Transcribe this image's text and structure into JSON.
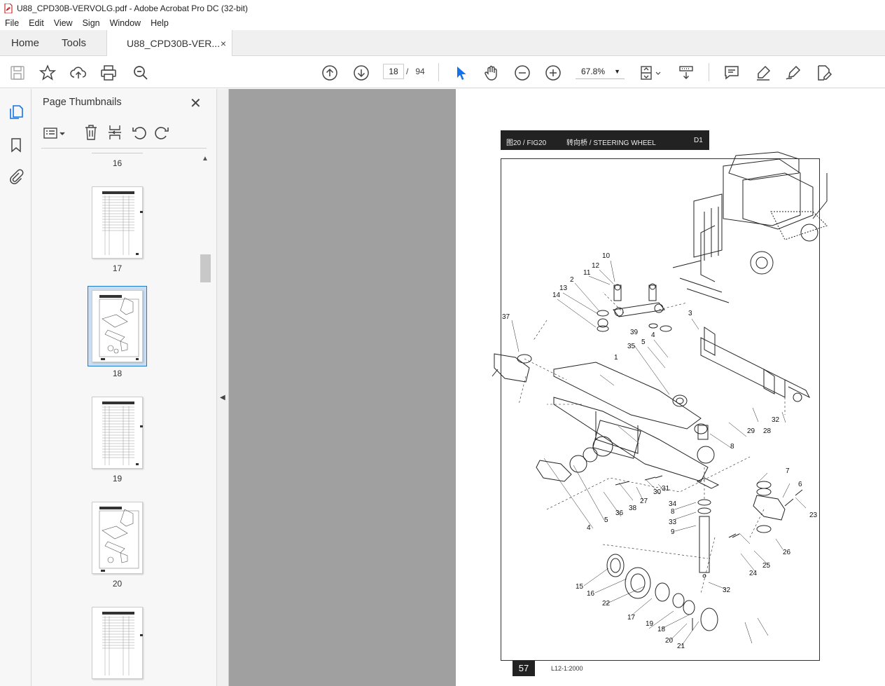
{
  "window": {
    "title": "U88_CPD30B-VERVOLG.pdf - Adobe Acrobat Pro DC (32-bit)"
  },
  "menu": [
    "File",
    "Edit",
    "View",
    "Sign",
    "Window",
    "Help"
  ],
  "tabs": {
    "home": "Home",
    "tools": "Tools",
    "document": "U88_CPD30B-VER...",
    "close": "×"
  },
  "toolbar": {
    "page_current": "18",
    "page_sep": "/",
    "page_total": "94",
    "zoom": "67.8%"
  },
  "panel": {
    "title": "Page Thumbnails",
    "close": "✕"
  },
  "thumbnails": [
    {
      "label": "16"
    },
    {
      "label": "17"
    },
    {
      "label": "18",
      "selected": true
    },
    {
      "label": "19"
    },
    {
      "label": "20"
    }
  ],
  "document": {
    "header_fig": "图20 / FIG20",
    "header_title": "转向桥 / STEERING WHEEL",
    "header_code": "D1",
    "page_number": "57",
    "page_code": "L12-1:2000",
    "callouts": [
      "10",
      "12",
      "11",
      "2",
      "13",
      "14",
      "37",
      "39",
      "4",
      "3",
      "35",
      "5",
      "1",
      "29",
      "28",
      "32",
      "8",
      "7",
      "6",
      "23",
      "27",
      "30",
      "31",
      "38",
      "36",
      "5",
      "4",
      "34",
      "8",
      "33",
      "9",
      "26",
      "24",
      "25",
      "32",
      "15",
      "16",
      "22",
      "17",
      "19",
      "18",
      "20",
      "21"
    ]
  },
  "colors": {
    "accent": "#1473e6",
    "selected_thumb": "#1e7bd0",
    "viewer_gray": "#a0a0a0"
  }
}
